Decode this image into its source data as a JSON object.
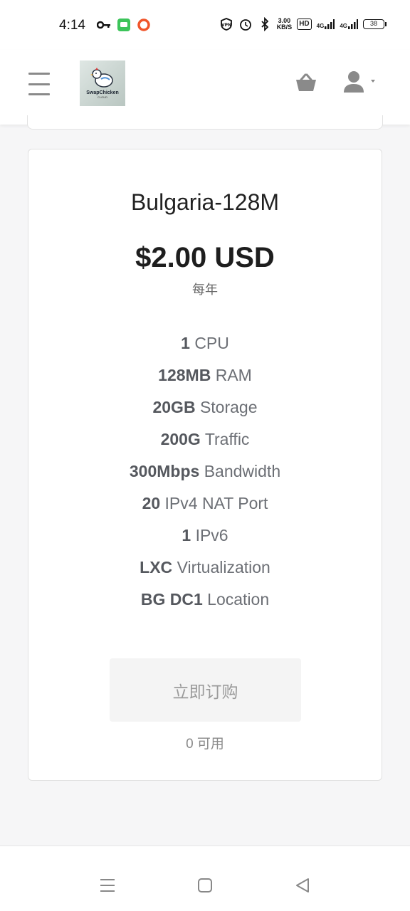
{
  "status_bar": {
    "time": "4:14",
    "speed_top": "3.00",
    "speed_bottom": "KB/S",
    "hd": "HD",
    "net1": "4G",
    "net2": "4G",
    "battery": "38"
  },
  "header": {
    "logo_text": "SwapChicken",
    "logo_sub": "CLOUD",
    "accent_color": "#8a8a8a"
  },
  "card": {
    "title": "Bulgaria-128M",
    "price": "$2.00 USD",
    "period": "每年",
    "features": [
      {
        "value": "1",
        "label": "CPU"
      },
      {
        "value": "128MB",
        "label": "RAM"
      },
      {
        "value": "20GB",
        "label": "Storage"
      },
      {
        "value": "200G",
        "label": "Traffic"
      },
      {
        "value": "300Mbps",
        "label": "Bandwidth"
      },
      {
        "value": "20",
        "label": "IPv4 NAT Port"
      },
      {
        "value": "1",
        "label": "IPv6"
      },
      {
        "value": "LXC",
        "label": "Virtualization"
      },
      {
        "value": "BG DC1",
        "label": "Location"
      }
    ],
    "order_button": "立即订购",
    "availability": "0 可用"
  }
}
